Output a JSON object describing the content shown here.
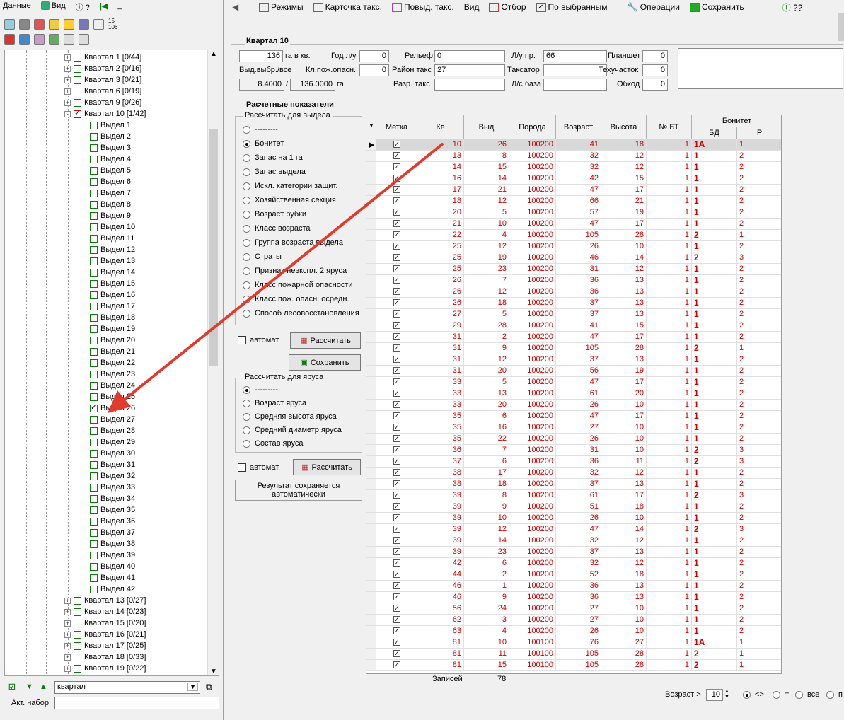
{
  "menu": {
    "data": "Данные",
    "view": "Вид",
    "help": "?"
  },
  "left_tree": {
    "quarters_before": [
      "Квартал 1 [0/44]",
      "Квартал 2 [0/16]",
      "Квартал 3 [0/21]",
      "Квартал 6 [0/19]",
      "Квартал 9 [0/26]"
    ],
    "expanded": "Квартал 10 [1/42]",
    "vydels": [
      "Выдел 1",
      "Выдел 2",
      "Выдел 3",
      "Выдел 4",
      "Выдел 5",
      "Выдел 6",
      "Выдел 7",
      "Выдел 8",
      "Выдел 9",
      "Выдел 10",
      "Выдел 11",
      "Выдел 12",
      "Выдел 13",
      "Выдел 14",
      "Выдел 15",
      "Выдел 16",
      "Выдел 17",
      "Выдел 18",
      "Выдел 19",
      "Выдел 20",
      "Выдел 21",
      "Выдел 22",
      "Выдел 23",
      "Выдел 24",
      "Выдел 25",
      "Выдел 26",
      "Выдел 27",
      "Выдел 28",
      "Выдел 29",
      "Выдел 30",
      "Выдел 31",
      "Выдел 32",
      "Выдел 33",
      "Выдел 34",
      "Выдел 35",
      "Выдел 36",
      "Выдел 37",
      "Выдел 38",
      "Выдел 39",
      "Выдел 40",
      "Выдел 41",
      "Выдел 42"
    ],
    "checked_vydel": "Выдел 26",
    "quarters_after": [
      "Квартал 13 [0/27]",
      "Квартал 14 [0/23]",
      "Квартал 15 [0/20]",
      "Квартал 16 [0/21]",
      "Квартал 17 [0/25]",
      "Квартал 18 [0/33]",
      "Квартал 19 [0/22]"
    ],
    "level_combo": "квартал",
    "active_set_label": "Акт. набор",
    "active_set_value": ""
  },
  "toolbar": {
    "modes": "Режимы",
    "card": "Карточка такс.",
    "repeated": "Повыд. такс.",
    "view": "Вид",
    "filter": "Отбор",
    "by_selected": "По выбранным",
    "operations": "Операции",
    "save": "Сохранить",
    "help": "??"
  },
  "quarter_header": {
    "title": "Квартал 10",
    "area_value": "136",
    "area_label": "га в кв.",
    "year_label": "Год л/у",
    "year_value": "0",
    "relief_label": "Рельеф",
    "relief_value": "0",
    "lu_label": "Л/у пр.",
    "lu_value": "66",
    "tablet_label": "Планшет",
    "tablet_value": "0",
    "selected_label": "Выд.выбр./все",
    "fire_class_label": "Кл.пож.опасн.",
    "fire_class_value": "0",
    "district_label": "Район такс",
    "district_value": "27",
    "taxator_label": "Таксатор",
    "taxator_value": "",
    "tech_label": "Техучасток",
    "tech_value": "0",
    "sel_area": "8.4000",
    "slash": "/",
    "all_area": "136.0000",
    "ga": "га",
    "razr_label": "Разр. такс",
    "razr_value": "",
    "ls_label": "Л/с база",
    "ls_value": "",
    "obhod_label": "Обход",
    "obhod_value": "0"
  },
  "calc": {
    "title": "Расчетные показатели",
    "group1_caption": "Рассчитать для выдела",
    "group1_options": [
      "---------",
      "Бонитет",
      "Запас на 1 га",
      "Запас выдела",
      "Искл. категории защит.",
      "Хозяйственная секция",
      "Возраст рубки",
      "Класс возраста",
      "Группа возраста выдела",
      "Страты",
      "Признак неэкспл. 2 яруса",
      "Класс пожарной опасности",
      "Класс пож. опасн. осредн.",
      "Способ лесовосстановления"
    ],
    "group1_selected": 1,
    "auto_label": "автомат.",
    "calc_button": "Рассчитать",
    "save_button": "Сохранить",
    "group2_caption": "Рассчитать для яруса",
    "group2_options": [
      "---------",
      "Возраст яруса",
      "Средняя высота яруса",
      "Средний диаметр яруса",
      "Состав яруса"
    ],
    "group2_selected": 0,
    "auto_label2": "автомат.",
    "calc_button2": "Рассчитать",
    "note_line1": "Результат сохраняется",
    "note_line2": "автоматически"
  },
  "grid": {
    "headers": {
      "mark": "Метка",
      "kv": "Кв",
      "vyd": "Выд",
      "poroda": "Порода",
      "vozrast": "Возраст",
      "vysota": "Высота",
      "bt": "№ БТ",
      "bonitet": "Бонитет",
      "bd": "БД",
      "r": "Р"
    },
    "rows": [
      [
        "10",
        "26",
        "100200",
        "41",
        "18",
        "1",
        "1А",
        "1"
      ],
      [
        "13",
        "8",
        "100200",
        "32",
        "12",
        "1",
        "1",
        "2"
      ],
      [
        "14",
        "15",
        "100200",
        "32",
        "12",
        "1",
        "1",
        "2"
      ],
      [
        "16",
        "14",
        "100200",
        "42",
        "15",
        "1",
        "1",
        "2"
      ],
      [
        "17",
        "21",
        "100200",
        "47",
        "17",
        "1",
        "1",
        "2"
      ],
      [
        "18",
        "12",
        "100200",
        "66",
        "21",
        "1",
        "1",
        "2"
      ],
      [
        "20",
        "5",
        "100200",
        "57",
        "19",
        "1",
        "1",
        "2"
      ],
      [
        "21",
        "10",
        "100200",
        "47",
        "17",
        "1",
        "1",
        "2"
      ],
      [
        "22",
        "4",
        "100200",
        "105",
        "28",
        "1",
        "2",
        "1"
      ],
      [
        "25",
        "12",
        "100200",
        "26",
        "10",
        "1",
        "1",
        "2"
      ],
      [
        "25",
        "19",
        "100200",
        "46",
        "14",
        "1",
        "2",
        "3"
      ],
      [
        "25",
        "23",
        "100200",
        "31",
        "12",
        "1",
        "1",
        "2"
      ],
      [
        "26",
        "7",
        "100200",
        "36",
        "13",
        "1",
        "1",
        "2"
      ],
      [
        "26",
        "12",
        "100200",
        "36",
        "13",
        "1",
        "1",
        "2"
      ],
      [
        "26",
        "18",
        "100200",
        "37",
        "13",
        "1",
        "1",
        "2"
      ],
      [
        "27",
        "5",
        "100200",
        "37",
        "13",
        "1",
        "1",
        "2"
      ],
      [
        "29",
        "28",
        "100200",
        "41",
        "15",
        "1",
        "1",
        "2"
      ],
      [
        "31",
        "2",
        "100200",
        "47",
        "17",
        "1",
        "1",
        "2"
      ],
      [
        "31",
        "9",
        "100200",
        "105",
        "28",
        "1",
        "2",
        "1"
      ],
      [
        "31",
        "12",
        "100200",
        "37",
        "13",
        "1",
        "1",
        "2"
      ],
      [
        "31",
        "20",
        "100200",
        "56",
        "19",
        "1",
        "1",
        "2"
      ],
      [
        "33",
        "5",
        "100200",
        "47",
        "17",
        "1",
        "1",
        "2"
      ],
      [
        "33",
        "13",
        "100200",
        "61",
        "20",
        "1",
        "1",
        "2"
      ],
      [
        "33",
        "20",
        "100200",
        "26",
        "10",
        "1",
        "1",
        "2"
      ],
      [
        "35",
        "6",
        "100200",
        "47",
        "17",
        "1",
        "1",
        "2"
      ],
      [
        "35",
        "16",
        "100200",
        "27",
        "10",
        "1",
        "1",
        "2"
      ],
      [
        "35",
        "22",
        "100200",
        "26",
        "10",
        "1",
        "1",
        "2"
      ],
      [
        "36",
        "7",
        "100200",
        "31",
        "10",
        "1",
        "2",
        "3"
      ],
      [
        "37",
        "6",
        "100200",
        "36",
        "11",
        "1",
        "2",
        "3"
      ],
      [
        "38",
        "17",
        "100200",
        "32",
        "12",
        "1",
        "1",
        "2"
      ],
      [
        "38",
        "18",
        "100200",
        "37",
        "13",
        "1",
        "1",
        "2"
      ],
      [
        "39",
        "8",
        "100200",
        "61",
        "17",
        "1",
        "2",
        "3"
      ],
      [
        "39",
        "9",
        "100200",
        "51",
        "18",
        "1",
        "1",
        "2"
      ],
      [
        "39",
        "10",
        "100200",
        "26",
        "10",
        "1",
        "1",
        "2"
      ],
      [
        "39",
        "12",
        "100200",
        "47",
        "14",
        "1",
        "2",
        "3"
      ],
      [
        "39",
        "14",
        "100200",
        "32",
        "12",
        "1",
        "1",
        "2"
      ],
      [
        "39",
        "23",
        "100200",
        "37",
        "13",
        "1",
        "1",
        "2"
      ],
      [
        "42",
        "6",
        "100200",
        "32",
        "12",
        "1",
        "1",
        "2"
      ],
      [
        "44",
        "2",
        "100200",
        "52",
        "18",
        "1",
        "1",
        "2"
      ],
      [
        "46",
        "1",
        "100200",
        "36",
        "13",
        "1",
        "1",
        "2"
      ],
      [
        "46",
        "9",
        "100200",
        "36",
        "13",
        "1",
        "1",
        "2"
      ],
      [
        "56",
        "24",
        "100200",
        "27",
        "10",
        "1",
        "1",
        "2"
      ],
      [
        "62",
        "3",
        "100200",
        "27",
        "10",
        "1",
        "1",
        "2"
      ],
      [
        "63",
        "4",
        "100200",
        "26",
        "10",
        "1",
        "1",
        "2"
      ],
      [
        "81",
        "10",
        "100100",
        "76",
        "27",
        "1",
        "1А",
        "1"
      ],
      [
        "81",
        "11",
        "100100",
        "105",
        "28",
        "1",
        "2",
        "1"
      ],
      [
        "81",
        "15",
        "100100",
        "105",
        "28",
        "1",
        "2",
        "1"
      ]
    ],
    "footer_label": "Записей",
    "footer_count": "78"
  },
  "status": {
    "age_label": "Возраст >",
    "age_value": "10",
    "op_ne": "<>",
    "op_eq": "=",
    "op_all": "все",
    "op_p": "п"
  }
}
